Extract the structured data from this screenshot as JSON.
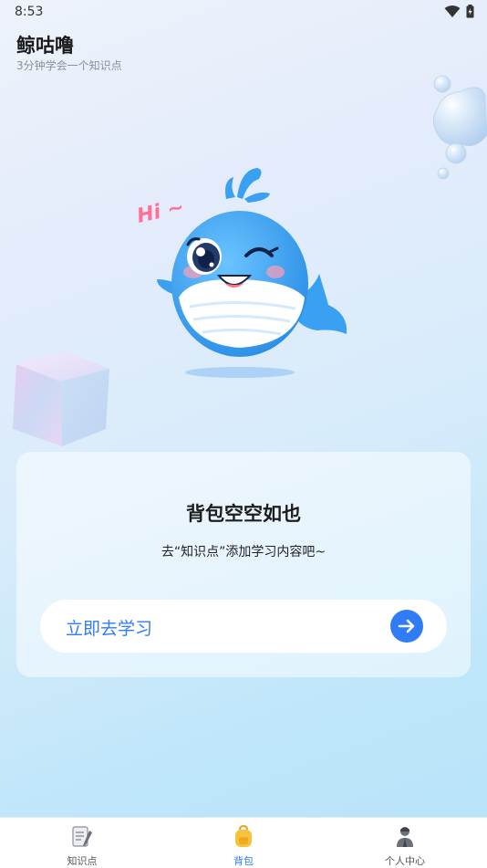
{
  "status_bar": {
    "time": "8:53"
  },
  "header": {
    "title": "鲸咕噜",
    "subtitle": "3分钟学会一个知识点"
  },
  "illustration": {
    "greeting": "Hi ~"
  },
  "empty_state": {
    "title": "背包空空如也",
    "description": "去“知识点”添加学习内容吧~",
    "button_label": "立即去学习"
  },
  "tabs": [
    {
      "label": "知识点",
      "icon": "notebook-icon",
      "active": false
    },
    {
      "label": "背包",
      "icon": "backpack-icon",
      "active": true
    },
    {
      "label": "个人中心",
      "icon": "person-icon",
      "active": false
    }
  ],
  "colors": {
    "accent": "#2f7cf6",
    "whale": "#3aa0f2",
    "greeting": "#ff6f9a"
  }
}
